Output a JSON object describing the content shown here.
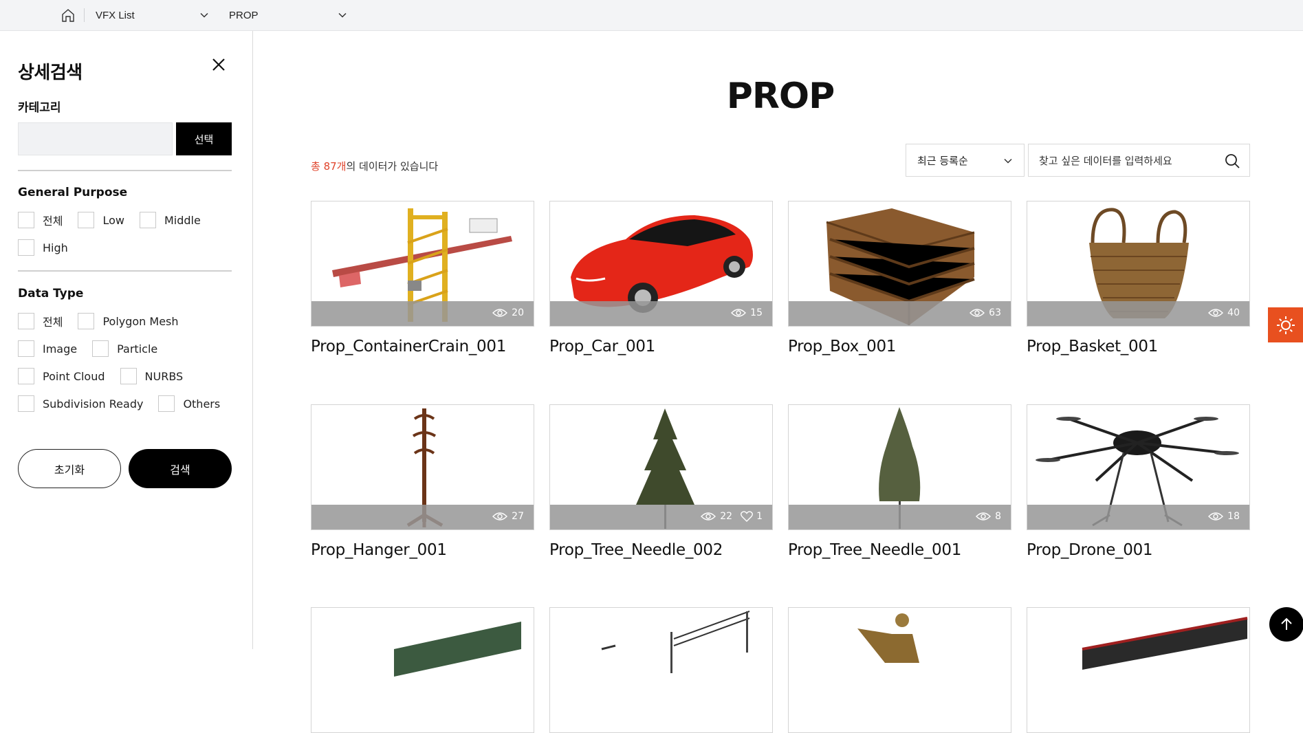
{
  "nav": {
    "home_icon": "home-icon",
    "select1": "VFX List",
    "select2": "PROP"
  },
  "sidebar": {
    "title": "상세검색",
    "category_label": "카테고리",
    "category_value": "",
    "category_button": "선택",
    "general_purpose": {
      "label": "General Purpose",
      "options": [
        "전체",
        "Low",
        "Middle",
        "High"
      ]
    },
    "data_type": {
      "label": "Data Type",
      "options": [
        "전체",
        "Polygon Mesh",
        "Image",
        "Particle",
        "Point Cloud",
        "NURBS",
        "Subdivision Ready",
        "Others"
      ]
    },
    "reset_button": "초기화",
    "search_button": "검색"
  },
  "main": {
    "title": "PROP",
    "count_prefix": "총 87개",
    "count_suffix": "의 데이터가 있습니다",
    "sort_value": "최근 등록순",
    "search_placeholder": "찾고 싶은 데이터를 입력하세요",
    "accent_color": "#e0442b",
    "items": [
      {
        "name": "Prop_ContainerCrain_001",
        "views": "20"
      },
      {
        "name": "Prop_Car_001",
        "views": "15"
      },
      {
        "name": "Prop_Box_001",
        "views": "63"
      },
      {
        "name": "Prop_Basket_001",
        "views": "40"
      },
      {
        "name": "Prop_Hanger_001",
        "views": "27"
      },
      {
        "name": "Prop_Tree_Needle_002",
        "views": "22",
        "likes": "1"
      },
      {
        "name": "Prop_Tree_Needle_001",
        "views": "8"
      },
      {
        "name": "Prop_Drone_001",
        "views": "18"
      }
    ]
  }
}
